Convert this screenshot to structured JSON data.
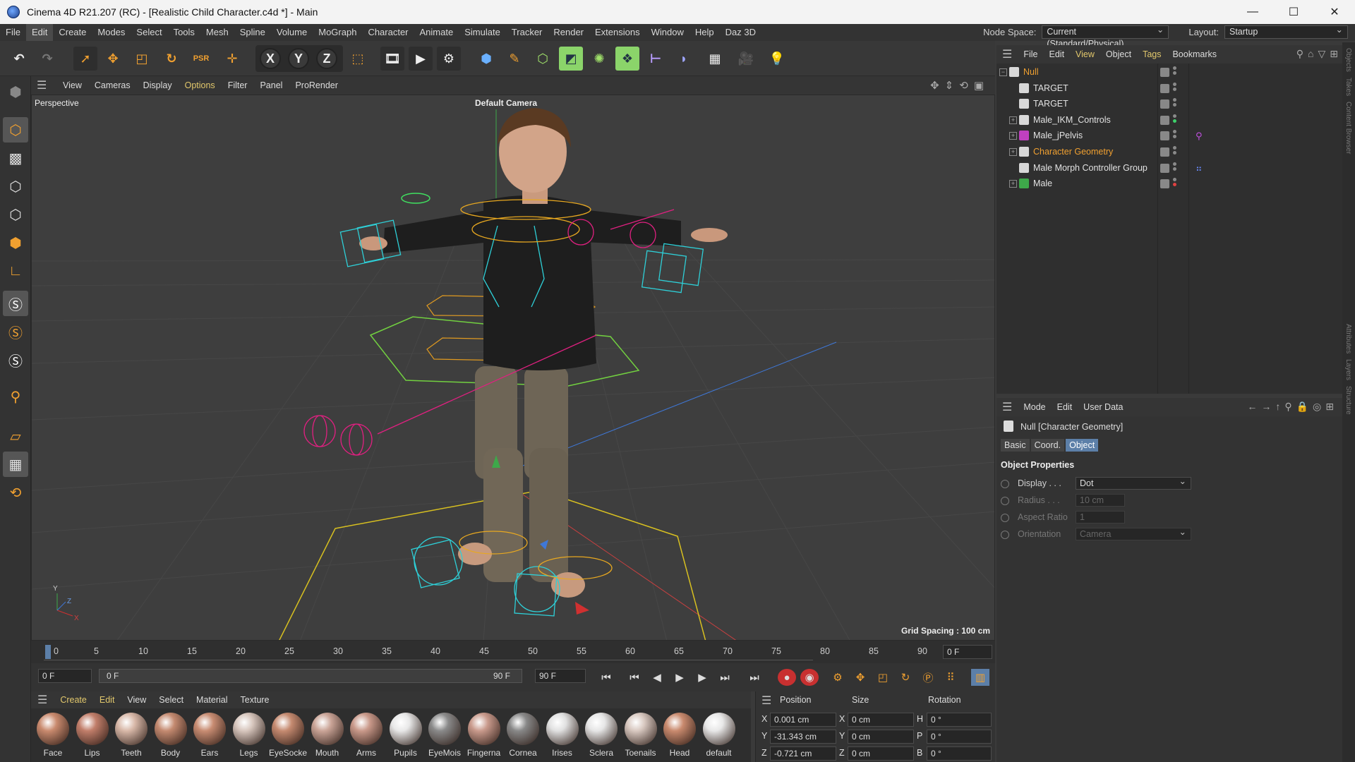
{
  "window": {
    "title": "Cinema 4D R21.207 (RC) - [Realistic Child Character.c4d *] - Main",
    "controls": [
      "—",
      "☐",
      "✕"
    ]
  },
  "menubar": {
    "items": [
      "File",
      "Edit",
      "Create",
      "Modes",
      "Select",
      "Tools",
      "Mesh",
      "Spline",
      "Volume",
      "MoGraph",
      "Character",
      "Animate",
      "Simulate",
      "Tracker",
      "Render",
      "Extensions",
      "Window",
      "Help",
      "Daz 3D"
    ],
    "active": "Edit",
    "node_space_label": "Node Space:",
    "node_space_value": "Current (Standard/Physical)",
    "layout_label": "Layout:",
    "layout_value": "Startup"
  },
  "viewport": {
    "menu": [
      "View",
      "Cameras",
      "Display",
      "Options",
      "Filter",
      "Panel",
      "ProRender"
    ],
    "highlighted": "Options",
    "projection": "Perspective",
    "camera": "Default Camera",
    "grid_spacing": "Grid Spacing : 100 cm"
  },
  "timeline": {
    "ticks": [
      "0",
      "5",
      "10",
      "15",
      "20",
      "25",
      "30",
      "35",
      "40",
      "45",
      "50",
      "55",
      "60",
      "65",
      "70",
      "75",
      "80",
      "85",
      "90"
    ],
    "current_frame": "0 F",
    "start_frame": "0 F",
    "range_left": "0 F",
    "range_right": "90 F",
    "end_frame": "90 F"
  },
  "materials": {
    "menu": [
      "Create",
      "Edit",
      "View",
      "Select",
      "Material",
      "Texture"
    ],
    "items": [
      {
        "name": "Face",
        "color": "#c98a6e"
      },
      {
        "name": "Lips",
        "color": "#c17e6a"
      },
      {
        "name": "Teeth",
        "color": "#d8b8a8"
      },
      {
        "name": "Body",
        "color": "#c48a70"
      },
      {
        "name": "Ears",
        "color": "#c88c72"
      },
      {
        "name": "Legs",
        "color": "#d7c6bd"
      },
      {
        "name": "EyeSocke",
        "color": "#c58a70"
      },
      {
        "name": "Mouth",
        "color": "#caa497"
      },
      {
        "name": "Arms",
        "color": "#c9998a"
      },
      {
        "name": "Pupils",
        "color": "#e8e8e8"
      },
      {
        "name": "EyeMois",
        "color": "#8a8a8a"
      },
      {
        "name": "Fingerna",
        "color": "#c99a8c"
      },
      {
        "name": "Cornea",
        "color": "#888888"
      },
      {
        "name": "Irises",
        "color": "#e0e0e0"
      },
      {
        "name": "Sclera",
        "color": "#e6e6e6"
      },
      {
        "name": "Toenails",
        "color": "#d8c8c0"
      },
      {
        "name": "Head",
        "color": "#c98a6e"
      },
      {
        "name": "default",
        "color": "#e8e8e8"
      }
    ]
  },
  "coordinates": {
    "headers": [
      "Position",
      "Size",
      "Rotation"
    ],
    "position": [
      {
        "axis": "X",
        "value": "0.001 cm"
      },
      {
        "axis": "Y",
        "value": "-31.343 cm"
      },
      {
        "axis": "Z",
        "value": "-0.721 cm"
      }
    ],
    "size": [
      {
        "axis": "X",
        "value": "0 cm"
      },
      {
        "axis": "Y",
        "value": "0 cm"
      },
      {
        "axis": "Z",
        "value": "0 cm"
      }
    ],
    "rotation": [
      {
        "axis": "H",
        "value": "0 °"
      },
      {
        "axis": "P",
        "value": "0 °"
      },
      {
        "axis": "B",
        "value": "0 °"
      }
    ]
  },
  "object_manager": {
    "menu": [
      "File",
      "Edit",
      "View",
      "Object",
      "Tags",
      "Bookmarks"
    ],
    "highlighted": [
      "View",
      "Tags"
    ],
    "objects": [
      {
        "name": "Null",
        "color": "#f0a030",
        "expand": "−"
      },
      {
        "name": "TARGET",
        "color": "#e2e2e2",
        "expand": ""
      },
      {
        "name": "TARGET",
        "color": "#e2e2e2",
        "expand": ""
      },
      {
        "name": "Male_IKM_Controls",
        "color": "#e2e2e2",
        "expand": "+"
      },
      {
        "name": "Male_jPelvis",
        "color": "#e2e2e2",
        "expand": "+"
      },
      {
        "name": "Character Geometry",
        "color": "#f0a030",
        "expand": "+"
      },
      {
        "name": "Male Morph Controller Group",
        "color": "#e2e2e2",
        "expand": ""
      },
      {
        "name": "Male",
        "color": "#e2e2e2",
        "expand": "+"
      }
    ],
    "side_tabs": [
      "Objects",
      "Takes",
      "Content Browser"
    ]
  },
  "attributes": {
    "menu": [
      "Mode",
      "Edit",
      "User Data"
    ],
    "object_name": "Null [Character Geometry]",
    "tabs": [
      "Basic",
      "Coord.",
      "Object"
    ],
    "active_tab": "Object",
    "section": "Object Properties",
    "properties": [
      {
        "label": "Display . . .",
        "value": "Dot",
        "enabled": true
      },
      {
        "label": "Radius . . .",
        "value": "10 cm",
        "enabled": false
      },
      {
        "label": "Aspect Ratio",
        "value": "1",
        "enabled": false
      },
      {
        "label": "Orientation",
        "value": "Camera",
        "enabled": false
      }
    ],
    "side_tabs": [
      "Attributes",
      "Layers",
      "Structure"
    ]
  }
}
